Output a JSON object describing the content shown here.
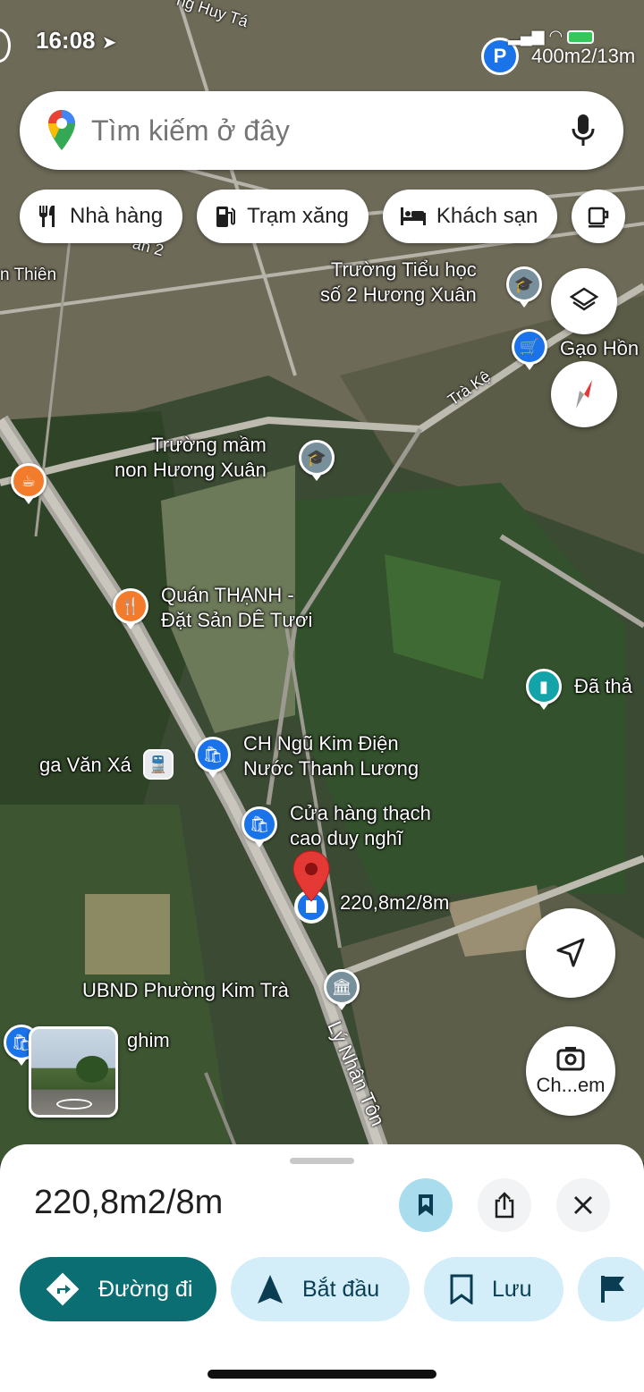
{
  "status_bar": {
    "time": "16:08",
    "right_text": "400m2/13m"
  },
  "search": {
    "placeholder": "Tìm kiếm ở đây"
  },
  "chips": [
    {
      "label": "Nhà hàng",
      "icon": "restaurant-icon"
    },
    {
      "label": "Trạm xăng",
      "icon": "gas-station-icon"
    },
    {
      "label": "Khách sạn",
      "icon": "hotel-icon"
    }
  ],
  "map": {
    "labels": {
      "school_primary": "Trường Tiểu học\nsố 2 Hương Xuân",
      "rice_shop": "Gạo Hồn",
      "kindergarten": "Trường mầm\nnon Hương Xuân",
      "restaurant": "Quán THẠNH -\nĐặt Sản DÊ Tươi",
      "saved": "Đã thả",
      "hardware_store": "CH Ngũ Kim Điện\nNước Thanh Lương",
      "station": "ga Văn Xá",
      "jelly_shop": "Cửa hàng thạch\ncao duy nghĩ",
      "pin_label": "220,8m2/8m",
      "ubnd": "UBND Phường Kim Trà",
      "ghim": "ghim",
      "thien": "n Thiên",
      "top_road": "ng Huy Tá",
      "road_tra_ke": "Trà Kệ",
      "road_ly_nhan_tong": "Lý Nhân Tôn",
      "road_an2": "an 2"
    },
    "colors": {
      "food": "#f27b2c",
      "school": "#78909c",
      "shop": "#1a73e8",
      "saved": "#12a4a8",
      "pin": "#e53935"
    }
  },
  "camera_button": {
    "label": "Ch...em"
  },
  "sheet": {
    "title": "220,8m2/8m",
    "actions": [
      {
        "label": "Đường đi",
        "icon": "directions-icon"
      },
      {
        "label": "Bắt đầu",
        "icon": "navigation-arrow-icon"
      },
      {
        "label": "Lưu",
        "icon": "bookmark-icon"
      }
    ]
  }
}
